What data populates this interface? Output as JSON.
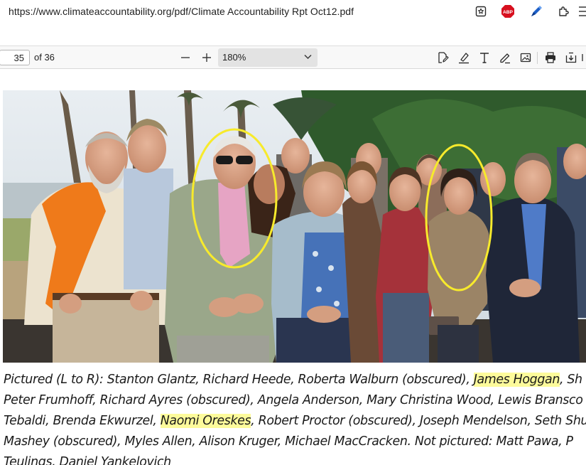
{
  "browser": {
    "url": "https://www.climateaccountability.org/pdf/Climate Accountability Rpt Oct12.pdf",
    "extensions": {
      "abp_label": "ABP"
    }
  },
  "pdf_toolbar": {
    "page_number": "35",
    "page_total": "of 36",
    "zoom": "180%"
  },
  "caption": {
    "lines": [
      {
        "parts": [
          {
            "text": "Pictured (L to R): Stanton Glantz, Richard Heede, Roberta Walburn (obscured), ",
            "highlight": false
          },
          {
            "text": "James Hoggan",
            "highlight": true
          },
          {
            "text": ", Sh",
            "highlight": false
          }
        ]
      },
      {
        "parts": [
          {
            "text": "Peter Frumhoff, Richard Ayres (obscured), Angela Anderson, Mary Christina Wood, Lewis Bransco",
            "highlight": false
          }
        ]
      },
      {
        "parts": [
          {
            "text": "Tebaldi, Brenda Ekwurzel, ",
            "highlight": false
          },
          {
            "text": "Naomi Oreskes",
            "highlight": true
          },
          {
            "text": ", Robert Proctor (obscured), Joseph Mendelson, Seth Shu",
            "highlight": false
          }
        ]
      },
      {
        "parts": [
          {
            "text": "Mashey (obscured), Myles Allen, Alison Kruger, Michael MacCracken. Not pictured: Matt Pawa, P",
            "highlight": false
          }
        ]
      },
      {
        "parts": [
          {
            "text": "Teulings, Daniel Yankelovich",
            "highlight": false
          }
        ]
      }
    ]
  },
  "colors": {
    "highlight": "#fdfb9b",
    "annotation_circle": "#f7ea2c",
    "abp_red": "#d7101f"
  }
}
